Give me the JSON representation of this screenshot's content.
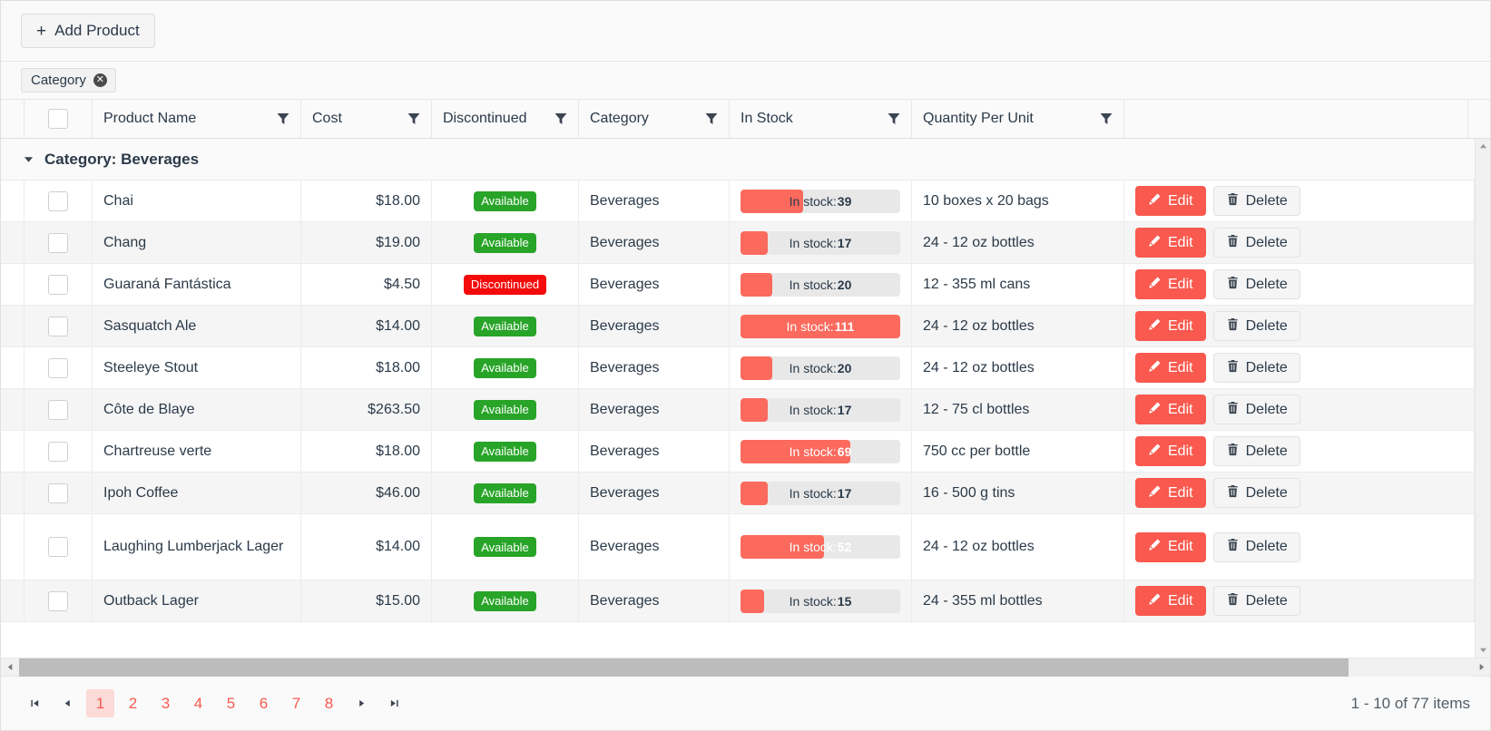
{
  "toolbar": {
    "add_product_label": "Add Product",
    "plus_glyph": "+"
  },
  "group_panel": {
    "chips": [
      {
        "label": "Category",
        "remove_glyph": "✕"
      }
    ]
  },
  "columns": [
    {
      "key": "name",
      "label": "Product Name",
      "filterable": true
    },
    {
      "key": "cost",
      "label": "Cost",
      "filterable": true
    },
    {
      "key": "disc",
      "label": "Discontinued",
      "filterable": true
    },
    {
      "key": "cat",
      "label": "Category",
      "filterable": true
    },
    {
      "key": "stock",
      "label": "In Stock",
      "filterable": true
    },
    {
      "key": "qty",
      "label": "Quantity Per Unit",
      "filterable": true
    }
  ],
  "group": {
    "caret_glyph": "▼",
    "label": "Category: Beverages"
  },
  "row_actions": {
    "edit_label": "Edit",
    "delete_label": "Delete"
  },
  "stock_label_prefix": "In stock:",
  "stock_max": 100,
  "status_labels": {
    "available": "Available",
    "discontinued": "Discontinued"
  },
  "rows": [
    {
      "name": "Chai",
      "cost": "$18.00",
      "status": "Available",
      "status_kind": "available",
      "category": "Beverages",
      "stock": 39,
      "qty": "10 boxes x 20 bags"
    },
    {
      "name": "Chang",
      "cost": "$19.00",
      "status": "Available",
      "status_kind": "available",
      "category": "Beverages",
      "stock": 17,
      "qty": "24 - 12 oz bottles"
    },
    {
      "name": "Guaraná Fantástica",
      "cost": "$4.50",
      "status": "Discontinued",
      "status_kind": "discontinued",
      "category": "Beverages",
      "stock": 20,
      "qty": "12 - 355 ml cans"
    },
    {
      "name": "Sasquatch Ale",
      "cost": "$14.00",
      "status": "Available",
      "status_kind": "available",
      "category": "Beverages",
      "stock": 111,
      "qty": "24 - 12 oz bottles"
    },
    {
      "name": "Steeleye Stout",
      "cost": "$18.00",
      "status": "Available",
      "status_kind": "available",
      "category": "Beverages",
      "stock": 20,
      "qty": "24 - 12 oz bottles"
    },
    {
      "name": "Côte de Blaye",
      "cost": "$263.50",
      "status": "Available",
      "status_kind": "available",
      "category": "Beverages",
      "stock": 17,
      "qty": "12 - 75 cl bottles"
    },
    {
      "name": "Chartreuse verte",
      "cost": "$18.00",
      "status": "Available",
      "status_kind": "available",
      "category": "Beverages",
      "stock": 69,
      "qty": "750 cc per bottle"
    },
    {
      "name": "Ipoh Coffee",
      "cost": "$46.00",
      "status": "Available",
      "status_kind": "available",
      "category": "Beverages",
      "stock": 17,
      "qty": "16 - 500 g tins"
    },
    {
      "name": "Laughing Lumberjack Lager",
      "cost": "$14.00",
      "status": "Available",
      "status_kind": "available",
      "category": "Beverages",
      "stock": 52,
      "qty": "24 - 12 oz bottles"
    },
    {
      "name": "Outback Lager",
      "cost": "$15.00",
      "status": "Available",
      "status_kind": "available",
      "category": "Beverages",
      "stock": 15,
      "qty": "24 - 355 ml bottles"
    }
  ],
  "pager": {
    "first_glyph": "⏮",
    "prev_glyph": "◀",
    "next_glyph": "▶",
    "last_glyph": "⏭",
    "pages": [
      "1",
      "2",
      "3",
      "4",
      "5",
      "6",
      "7",
      "8"
    ],
    "active_page": "1",
    "info": "1 - 10 of 77 items"
  },
  "colors": {
    "accent": "#f9594e",
    "available": "#28a428",
    "discontinued": "#f40a0a",
    "progress_fill": "#fb6a5d",
    "progress_track": "#e8e8e8",
    "page_active_bg": "#fbdad7"
  }
}
